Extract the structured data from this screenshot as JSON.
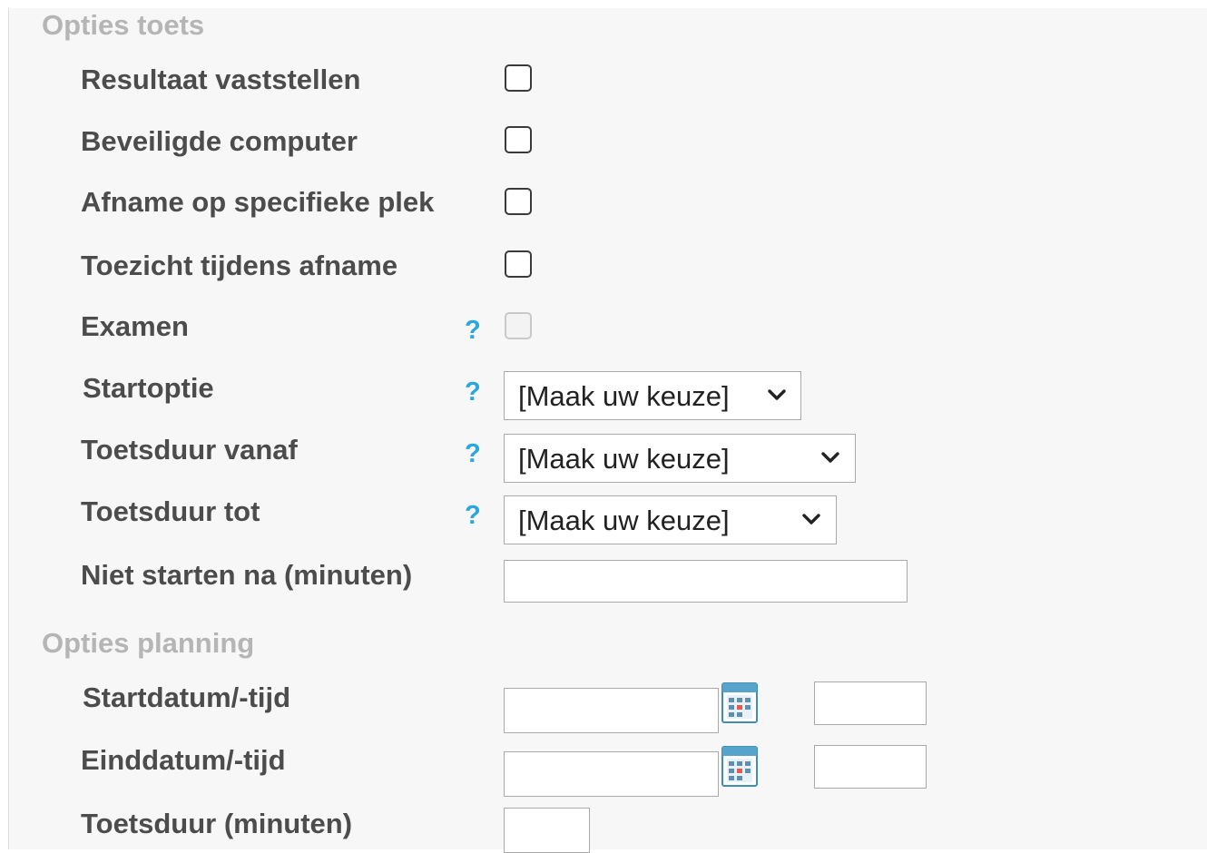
{
  "sections": {
    "test_options_title": "Opties toets",
    "planning_options_title": "Opties planning"
  },
  "test_options": {
    "resultaat_label": "Resultaat vaststellen",
    "beveiligde_label": "Beveiligde computer",
    "afname_label": "Afname op specifieke plek",
    "toezicht_label": "Toezicht tijdens afname",
    "examen_label": "Examen",
    "startoptie_label": "Startoptie",
    "toetsduur_vanaf_label": "Toetsduur vanaf",
    "toetsduur_tot_label": "Toetsduur tot",
    "niet_starten_label": "Niet starten na (minuten)",
    "help_glyph": "?",
    "startoptie_value": "[Maak uw keuze]",
    "toetsduur_vanaf_value": "[Maak uw keuze]",
    "toetsduur_tot_value": "[Maak uw keuze]",
    "niet_starten_value": "",
    "checkboxes": {
      "resultaat_checked": false,
      "beveiligde_checked": false,
      "afname_checked": false,
      "toezicht_checked": false,
      "examen_checked": false,
      "examen_disabled": true
    }
  },
  "planning_options": {
    "startdatum_label": "Startdatum/-tijd",
    "einddatum_label": "Einddatum/-tijd",
    "toetsduur_label": "Toetsduur (minuten)",
    "startdatum_date_value": "",
    "startdatum_time_value": "",
    "einddatum_date_value": "",
    "einddatum_time_value": "",
    "toetsduur_value": ""
  },
  "icons": {
    "help": "question-mark-icon",
    "calendar": "calendar-icon",
    "dropdown": "chevron-down-icon"
  },
  "colors": {
    "help_accent": "#2aa7e0",
    "section_title": "#b5b5b5",
    "label": "#4c4c4c",
    "panel_background": "#f7f7f7"
  }
}
